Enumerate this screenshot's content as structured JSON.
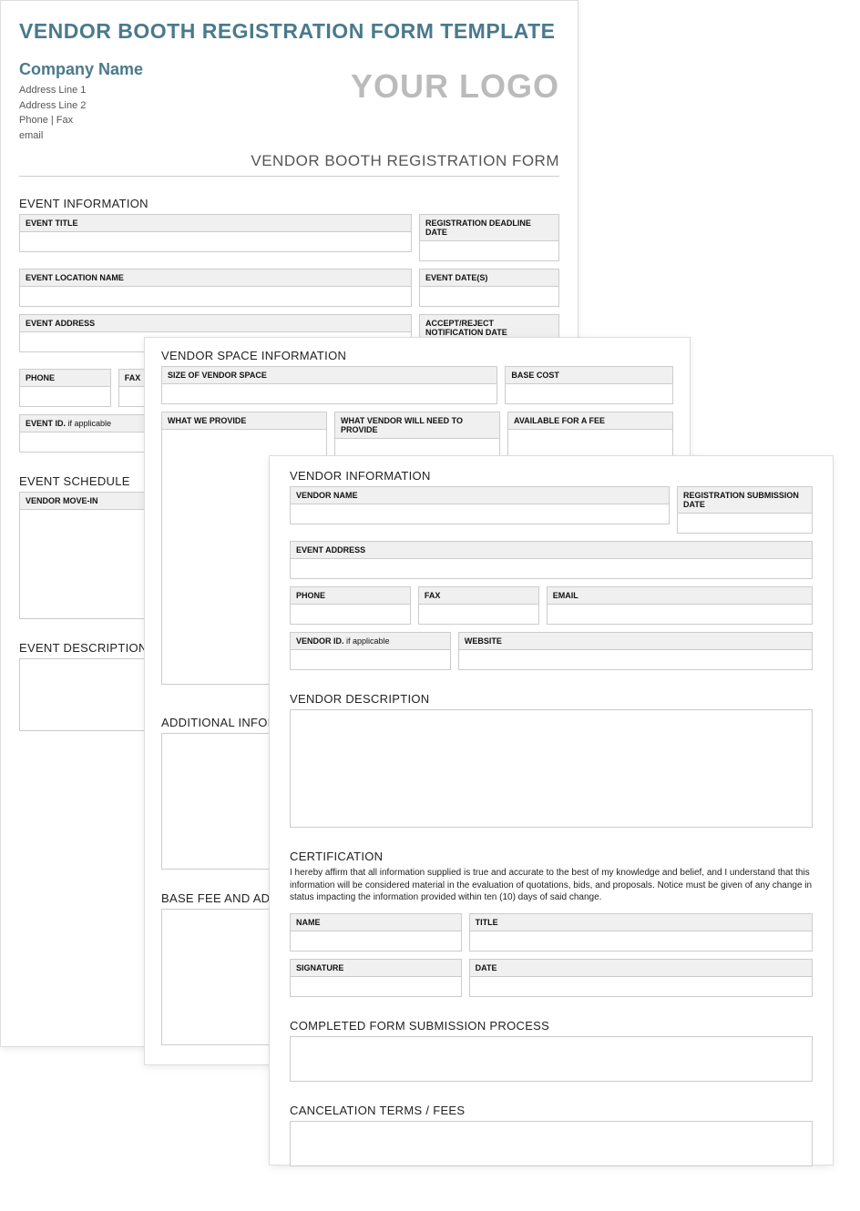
{
  "page1": {
    "title": "VENDOR BOOTH REGISTRATION FORM TEMPLATE",
    "company_name": "Company Name",
    "addr1": "Address Line 1",
    "addr2": "Address Line 2",
    "phonefax": "Phone | Fax",
    "email": "email",
    "logo": "YOUR LOGO",
    "form_title": "VENDOR BOOTH REGISTRATION FORM",
    "sect_event_info": "EVENT INFORMATION",
    "event_title": "EVENT TITLE",
    "reg_deadline": "REGISTRATION DEADLINE DATE",
    "event_location": "EVENT LOCATION NAME",
    "event_dates": "EVENT DATE(S)",
    "event_address": "EVENT ADDRESS",
    "accept_reject": "ACCEPT/REJECT NOTIFICATION DATE",
    "phone": "PHONE",
    "fax": "FAX",
    "event_id": "EVENT ID.",
    "if_applicable": " if applicable",
    "sect_schedule": "EVENT SCHEDULE",
    "vendor_movein": "VENDOR MOVE-IN",
    "sect_desc": "EVENT DESCRIPTION"
  },
  "page2": {
    "sect_space": "VENDOR SPACE INFORMATION",
    "size": "SIZE OF VENDOR SPACE",
    "base_cost": "BASE COST",
    "we_provide": "WHAT WE PROVIDE",
    "vendor_provide": "WHAT VENDOR WILL NEED TO PROVIDE",
    "for_fee": "AVAILABLE FOR A FEE",
    "sect_additional": "ADDITIONAL INFORMATION",
    "sect_basefee": "BASE FEE AND ADDITIONS"
  },
  "page3": {
    "sect_vendor": "VENDOR INFORMATION",
    "vendor_name": "VENDOR NAME",
    "reg_submit": "REGISTRATION SUBMISSION DATE",
    "event_address": "EVENT ADDRESS",
    "phone": "PHONE",
    "fax": "FAX",
    "email_lbl": "EMAIL",
    "vendor_id": "VENDOR ID.",
    "if_applicable": " if applicable",
    "website": "WEBSITE",
    "sect_vdesc": "VENDOR DESCRIPTION",
    "sect_cert": "CERTIFICATION",
    "cert_text": "I hereby affirm that all information supplied is true and accurate to the best of my knowledge and belief, and I understand that this information will be considered material in the evaluation of quotations, bids, and proposals. Notice must be given of any change in status impacting the information provided within ten (10) days of said change.",
    "name": "NAME",
    "title_lbl": "TITLE",
    "sig": "SIGNATURE",
    "date": "DATE",
    "sect_submit": "COMPLETED FORM SUBMISSION PROCESS",
    "sect_cancel": "CANCELATION TERMS / FEES"
  }
}
